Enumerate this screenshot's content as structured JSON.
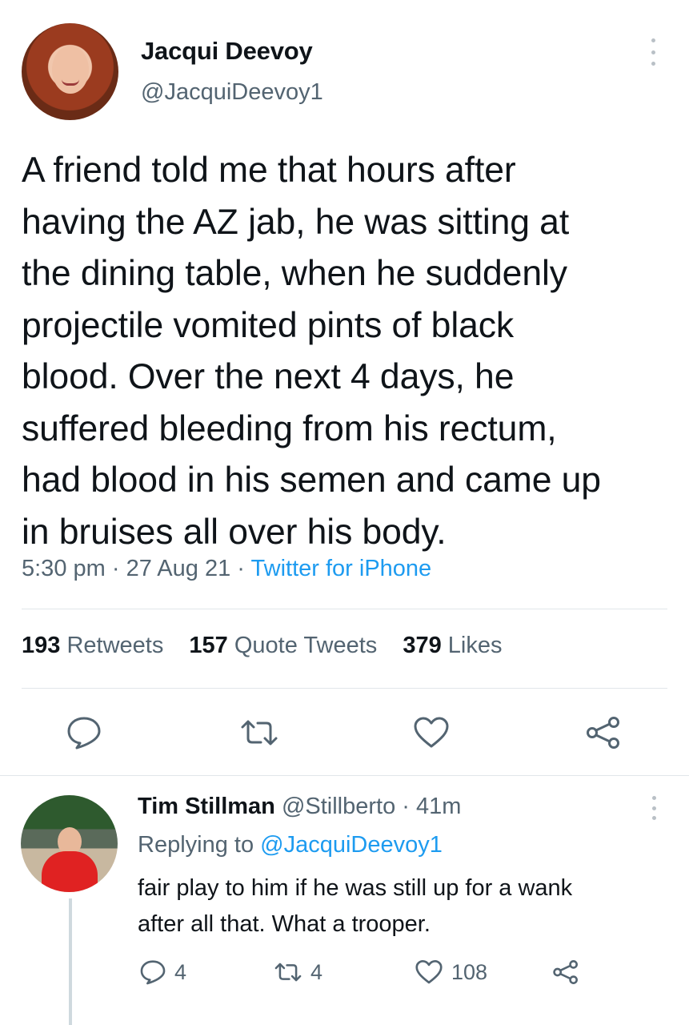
{
  "tweet": {
    "author_name": "Jacqui Deevoy",
    "author_handle": "@JacquiDeevoy1",
    "text_lines": [
      "A friend told me that hours after",
      "having the AZ jab, he was sitting at",
      "the dining table, when he suddenly",
      "projectile vomited pints of black",
      "blood. Over the next 4 days, he",
      "suffered bleeding from his rectum,",
      "had blood in his semen and came up",
      "in bruises all over his body."
    ],
    "time": "5:30 pm",
    "separator": "·",
    "date": "27 Aug 21",
    "source": "Twitter for iPhone",
    "stats": {
      "retweets_count": "193",
      "retweets_label": "Retweets",
      "quote_count": "157",
      "quote_label": "Quote Tweets",
      "likes_count": "379",
      "likes_label": "Likes"
    },
    "icons": [
      "more-icon",
      "reply-icon",
      "retweet-icon",
      "like-icon",
      "share-icon"
    ]
  },
  "reply": {
    "author_name": "Tim Stillman",
    "author_handle": "@Stillberto",
    "separator": "·",
    "time_ago": "41m",
    "replying_prefix": "Replying to",
    "replying_to": "@JacquiDeevoy1",
    "text_lines": [
      "fair play to him if he was still up for a wank",
      "after all that. What a trooper."
    ],
    "reply_count": "4",
    "retweet_count": "4",
    "like_count": "108"
  },
  "colors": {
    "text": "#0f1419",
    "secondary": "#536471",
    "accent": "#1d9bf0",
    "divider": "#e1e6ea"
  }
}
